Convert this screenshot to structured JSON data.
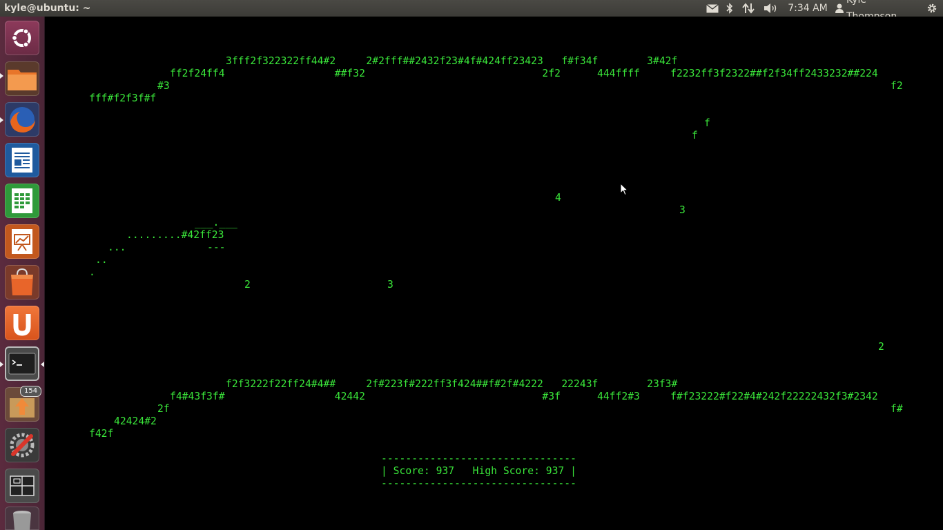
{
  "window": {
    "title": "kyle@ubuntu: ~"
  },
  "panel": {
    "clock": "7:34 AM",
    "user_name": "Kyle Thompson",
    "indicators": [
      "mail-icon",
      "bluetooth-icon",
      "network-icon",
      "volume-icon",
      "power-gear-icon"
    ]
  },
  "launcher": {
    "items": [
      {
        "name": "ubuntu-dash"
      },
      {
        "name": "files"
      },
      {
        "name": "firefox"
      },
      {
        "name": "libreoffice-writer"
      },
      {
        "name": "libreoffice-calc"
      },
      {
        "name": "libreoffice-impress"
      },
      {
        "name": "ubuntu-software-center"
      },
      {
        "name": "ubuntu-one"
      },
      {
        "name": "terminal"
      },
      {
        "name": "software-updater",
        "badge": "154"
      },
      {
        "name": "system-settings"
      },
      {
        "name": "workspace-switcher"
      },
      {
        "name": "trash"
      }
    ]
  },
  "terminal": {
    "lines": [
      "3fff2f322322ff44#2     2#2fff##2432f23#4f#424ff23423   f#f34f        3#42f",
      "ff2f24ff4                  ##f32                             2f2      444ffff     f2232ff3f2322##f2f34ff2433232##224",
      "#3",
      "f2",
      "fff#f2f3f#f",
      "f",
      "f",
      "4",
      "3",
      "___.___",
      ".........#42ff23",
      "...",
      "---",
      "..",
      ".",
      "2",
      "3",
      "2",
      "f2f3222f22ff24#4##     2f#223f#222ff3f424##f#2f#4222   22243f        23f3#",
      "f4#43f3f#                  42442                             #3f      44ff2#3     f#f23222#f22#4#242f22222432f3#2342",
      "2f",
      "f#",
      "42424#2",
      "f42f",
      "--------------------------------",
      "| Score: 937   High Score: 937 |",
      "--------------------------------"
    ]
  }
}
